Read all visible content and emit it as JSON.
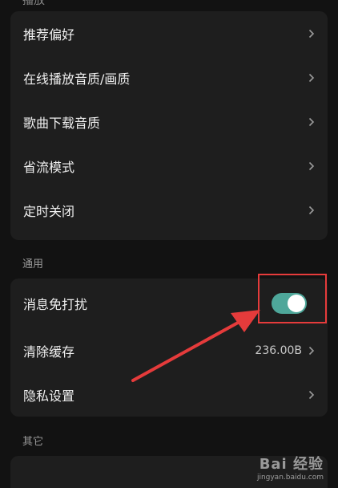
{
  "top_section_label": "播放",
  "playback_items": [
    {
      "label": "推荐偏好"
    },
    {
      "label": "在线播放音质/画质"
    },
    {
      "label": "歌曲下载音质"
    },
    {
      "label": "省流模式"
    },
    {
      "label": "定时关闭"
    }
  ],
  "general_section": {
    "title": "通用",
    "dnd_label": "消息免打扰",
    "dnd_toggle_on": true,
    "clear_cache_label": "清除缓存",
    "clear_cache_value": "236.00B",
    "privacy_label": "隐私设置"
  },
  "other_section": {
    "title": "其它"
  },
  "colors": {
    "toggle_on": "#4ea79a",
    "highlight": "#e53b3b"
  },
  "watermark": {
    "main": "Bai 经验",
    "sub": "jingyan.baidu.com"
  }
}
